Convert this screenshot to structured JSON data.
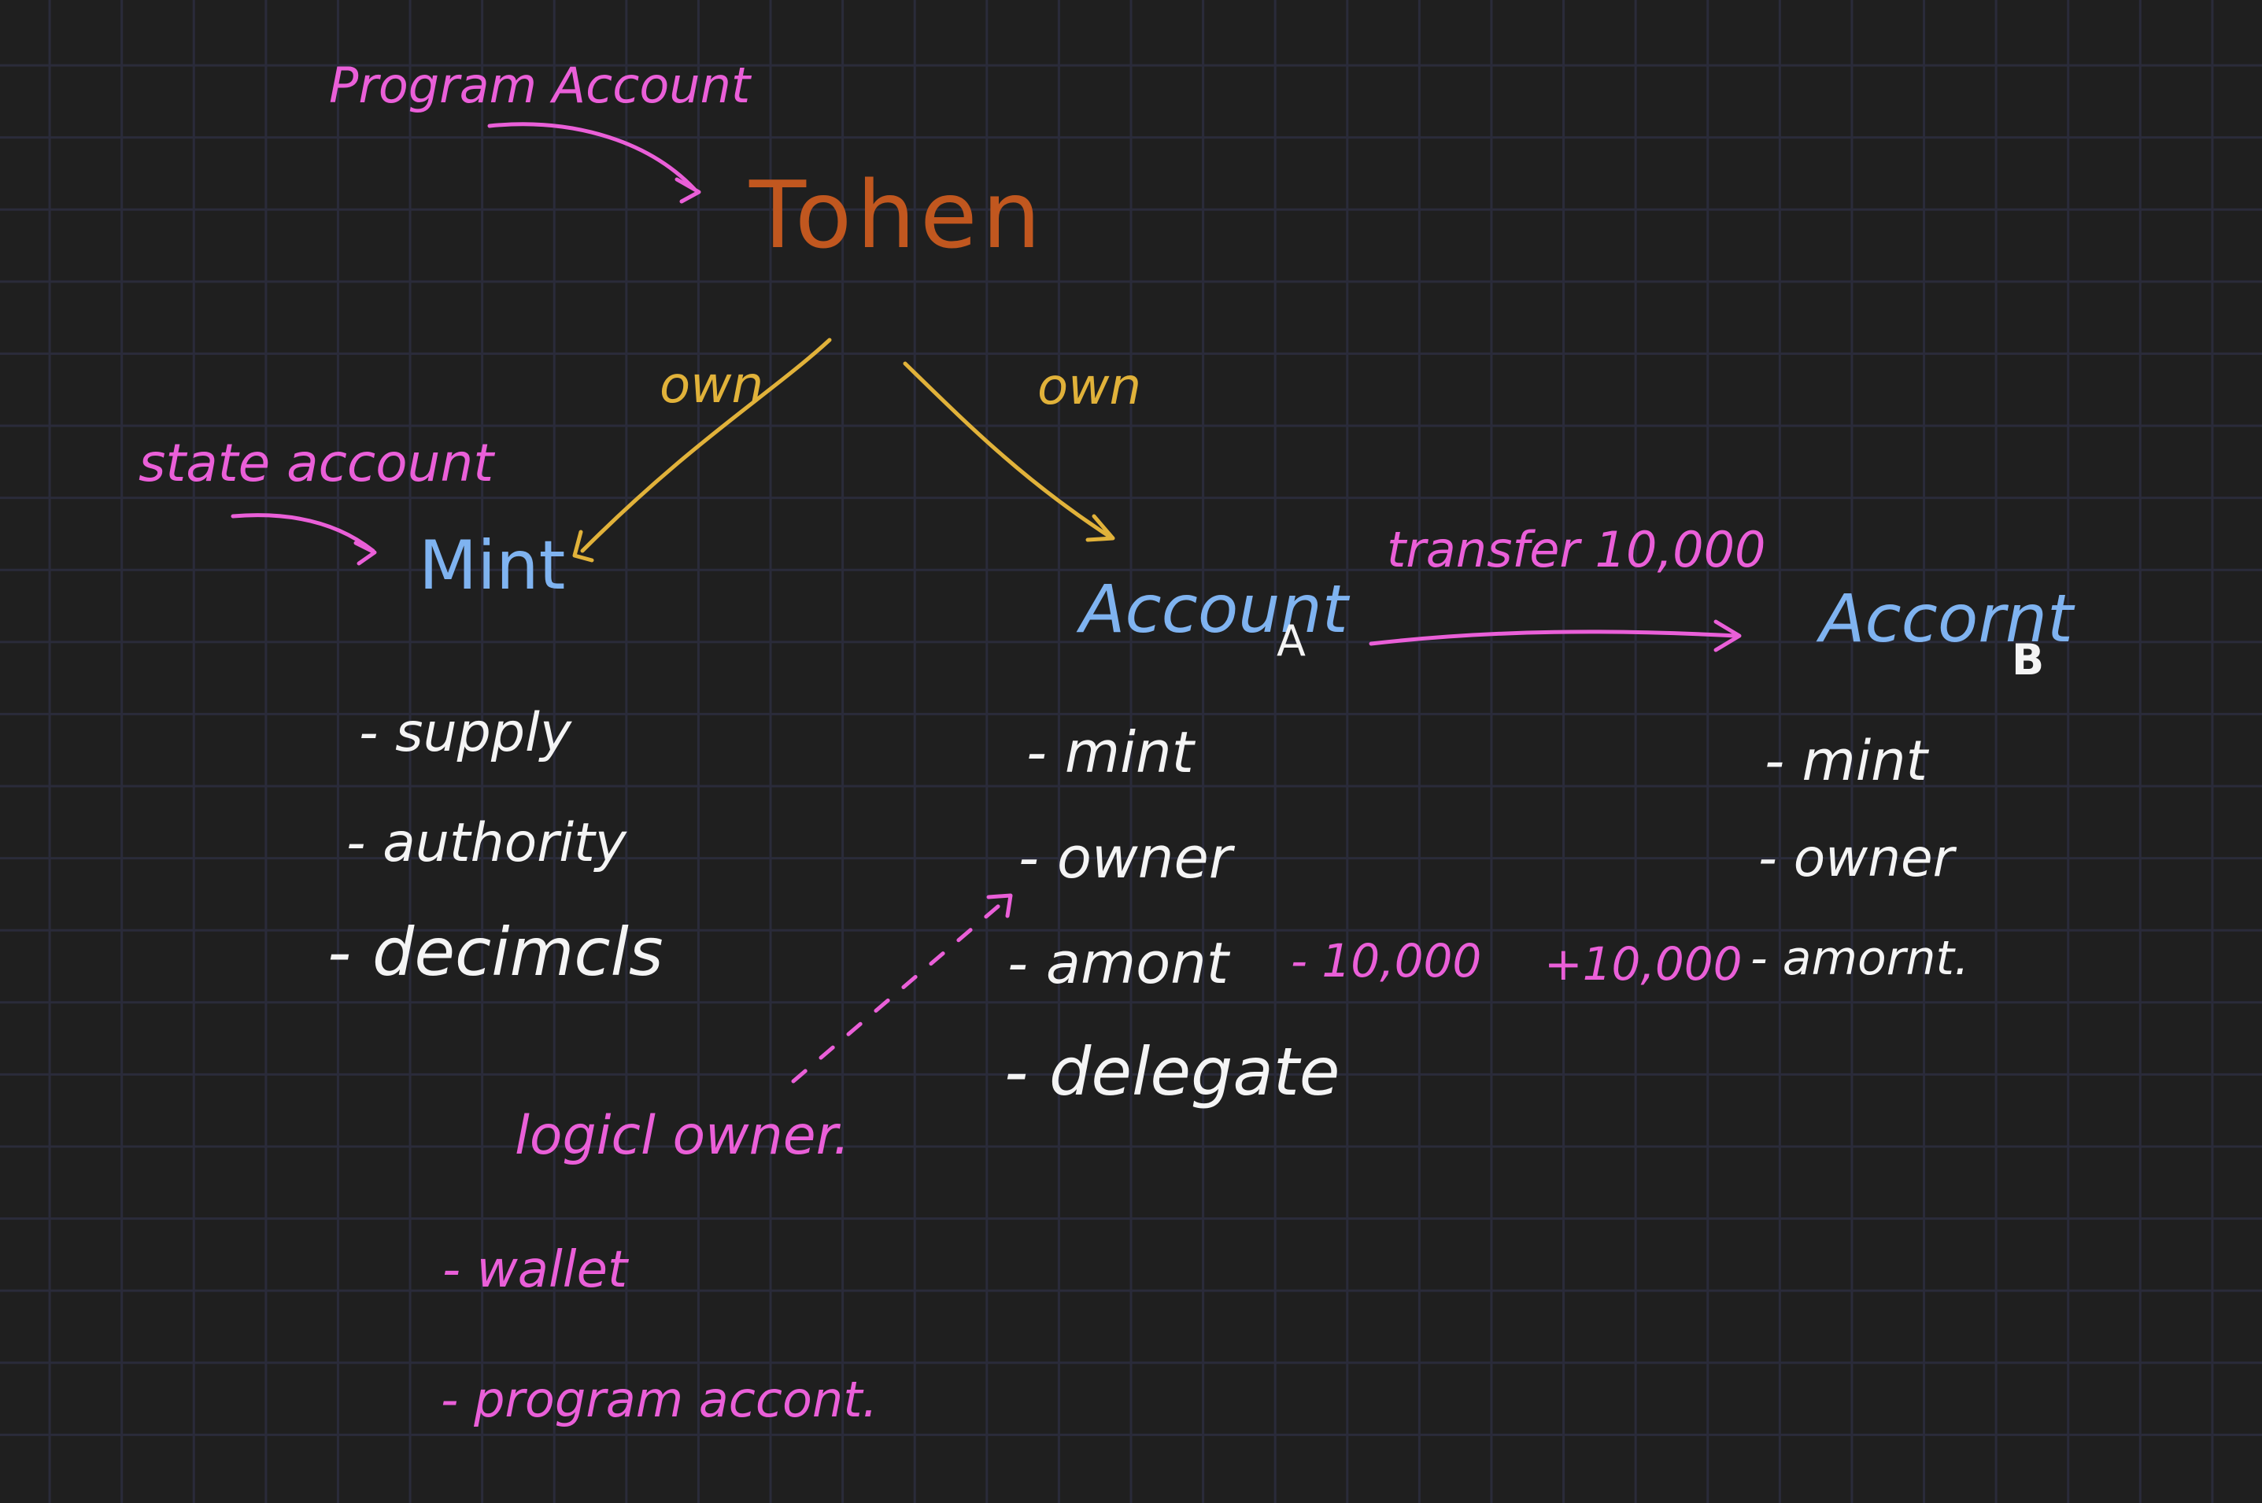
{
  "diagram": {
    "program_account_label": "Program Account",
    "token_label": "Tohen",
    "own_left_label": "own",
    "own_right_label": "own",
    "state_account_label": "state account",
    "mint": {
      "title": "Mint",
      "fields": [
        "- supply",
        "- authority",
        "- decimcls"
      ]
    },
    "account_a": {
      "title": "Account",
      "subscript": "A",
      "fields": [
        "- mint",
        "- owner",
        "- amont",
        "- delegate"
      ]
    },
    "transfer_label": "transfer 10,000",
    "account_b": {
      "title": "Accornt",
      "subscript": "B",
      "fields": [
        "- mint",
        "- owner",
        "- amornt."
      ]
    },
    "debit_label": "- 10,000",
    "credit_label": "+10,000",
    "logical_owner": {
      "title": "logicl owner.",
      "items": [
        "- wallet",
        "- program accont."
      ]
    },
    "colors": {
      "background": "#1f1f1f",
      "grid": "#2a2b3a",
      "pink_annotation": "#ea5fd8",
      "orange_token": "#c1571f",
      "yellow_own": "#e1b23a",
      "blue_titles": "#7fb3f0",
      "white_fields": "#f4f4f4"
    }
  }
}
